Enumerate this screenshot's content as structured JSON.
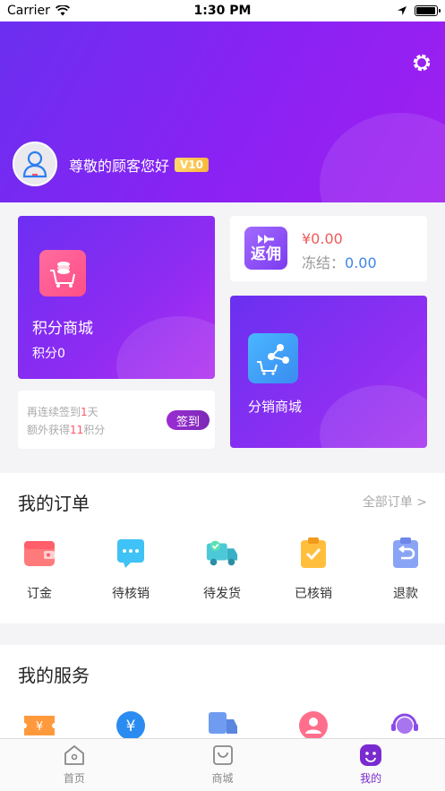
{
  "status_bar": {
    "carrier": "Carrier",
    "time": "1:30 PM",
    "battery_level": 0.95
  },
  "header": {
    "greeting": "尊敬的顾客您好",
    "vip_level": "V10"
  },
  "points_card": {
    "title": "积分商城",
    "points_label": "积分0"
  },
  "checkin": {
    "line1_prefix": "再连续签到",
    "line1_days": "1",
    "line1_suffix": "天",
    "line2_prefix": "额外获得",
    "line2_points": "11",
    "line2_suffix": "积分",
    "button": "签到"
  },
  "rebate": {
    "icon_label": "返佣",
    "amount": "¥0.00",
    "frozen_label": "冻结：",
    "frozen_value": "0.00"
  },
  "distribution": {
    "title": "分销商城"
  },
  "orders": {
    "title": "我的订单",
    "all_link": "全部订单 >",
    "items": [
      {
        "label": "订金",
        "icon": "wallet-icon"
      },
      {
        "label": "待核销",
        "icon": "message-icon"
      },
      {
        "label": "待发货",
        "icon": "truck-icon"
      },
      {
        "label": "已核销",
        "icon": "clipboard-check-icon"
      },
      {
        "label": "退款",
        "icon": "return-icon"
      }
    ]
  },
  "services": {
    "title": "我的服务",
    "items": [
      "coupon-icon",
      "yuan-coin-icon",
      "delivery-icon",
      "user-circle-icon",
      "support-agent-icon"
    ]
  },
  "tabbar": {
    "items": [
      {
        "label": "首页",
        "icon": "home-icon"
      },
      {
        "label": "商城",
        "icon": "shopping-bag-icon"
      },
      {
        "label": "我的",
        "icon": "profile-face-icon",
        "active": true
      }
    ]
  },
  "colors": {
    "accent": "#7a2bd0",
    "header_start": "#6b2ff0",
    "header_end": "#a01ff0",
    "price": "#f05a5a",
    "link_blue": "#3e86e8"
  }
}
